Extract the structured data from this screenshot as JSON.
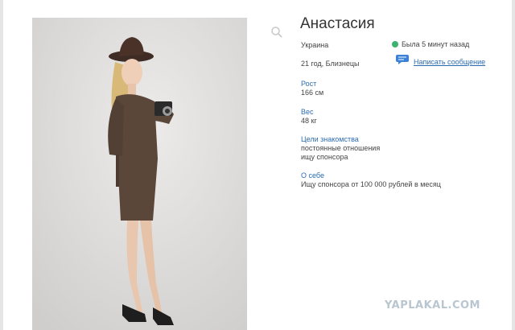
{
  "profile": {
    "name": "Анастасия",
    "country": "Украина",
    "age_sign": "21 год, Близнецы",
    "status": "Была 5 минут назад",
    "message_link": "Написать сообщение",
    "height_label": "Рост",
    "height_value": "166 см",
    "weight_label": "Вес",
    "weight_value": "48 кг",
    "goals_label": "Цели знакомства",
    "goals_line1": "постоянные отношения",
    "goals_line2": "ищу спонсора",
    "about_label": "О себе",
    "about_text": "Ищу спонсора от 100 000 рублей в месяц"
  },
  "watermark": "YAPLAKAL.COM",
  "colors": {
    "link": "#2b6cb0",
    "online": "#3cb371"
  },
  "icons": {
    "zoom": "magnifier-icon",
    "message": "speech-bubble-icon",
    "status": "online-dot-icon"
  }
}
